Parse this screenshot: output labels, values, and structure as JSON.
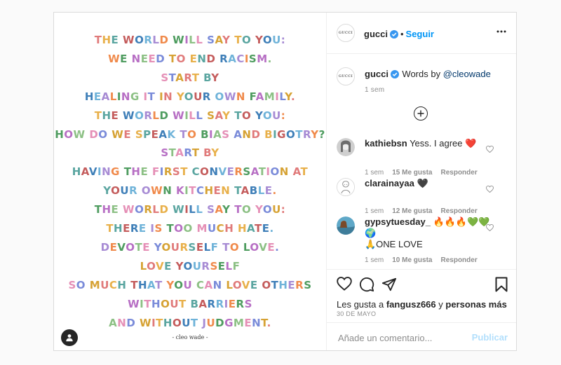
{
  "post": {
    "poem_lines": [
      "THE WORLD WILL SAY TO YOU:",
      "WE NEED TO END RACISM.",
      "START BY",
      "HEALING IT IN YOUR OWN FAMILY.",
      "THE WORLD WILL SAY TO YOU:",
      "HOW DO WE SPEAK TO BIAS AND BIGOTRY?",
      "START BY",
      "HAVING THE FIRST CONVERSATION AT",
      "YOUR OWN KITCHEN TABLE.",
      "THE WORLD WILL SAY TO YOU:",
      "THERE IS TOO MUCH HATE.",
      "DEVOTE YOURSELF TO LOVE.",
      "LOVE YOURSELF",
      "SO MUCH THAT YOU CAN LOVE OTHERS",
      "WITHOUT BARRIERS",
      "AND WITHOUT JUDGMENT."
    ],
    "signature": "- cleo wade -",
    "letter_colors": [
      "#e07a7a",
      "#6fb3d9",
      "#8cc084",
      "#e8b04a",
      "#a78bd4",
      "#e58fb6",
      "#5aa5a0",
      "#f08a4b",
      "#7a8bd9",
      "#c45c5c",
      "#4e9c5f",
      "#d6a234",
      "#3f7fb8",
      "#b76fc4"
    ]
  },
  "header": {
    "avatar_text": "GUCCI",
    "username": "gucci",
    "separator": "•",
    "follow_label": "Seguir"
  },
  "caption": {
    "username": "gucci",
    "text": "Words by ",
    "mention": "@cleowade",
    "time": "1 sem"
  },
  "comments": [
    {
      "username": "kathiebsn",
      "text": "Yess. I agree ❤️",
      "time": "1 sem",
      "likes": "15 Me gusta",
      "reply": "Responder"
    },
    {
      "username": "clarainayaa",
      "text": "🖤",
      "time": "1 sem",
      "likes": "12 Me gusta",
      "reply": "Responder"
    },
    {
      "username": "gypsytuesday_",
      "text": "🔥🔥🔥💚💚🌍\n🙏ONE LOVE",
      "time": "1 sem",
      "likes": "10 Me gusta",
      "reply": "Responder"
    }
  ],
  "likes_line": {
    "prefix": "Les gusta a ",
    "user": "fangusz666",
    "middle": " y ",
    "rest": "personas más"
  },
  "date": "30 DE MAYO",
  "compose": {
    "placeholder": "Añade un comentario...",
    "publish_label": "Publicar"
  },
  "colors": {
    "accent": "#0095f6",
    "publish_disabled": "#b2dffc",
    "heart_red": "#ed4956"
  }
}
